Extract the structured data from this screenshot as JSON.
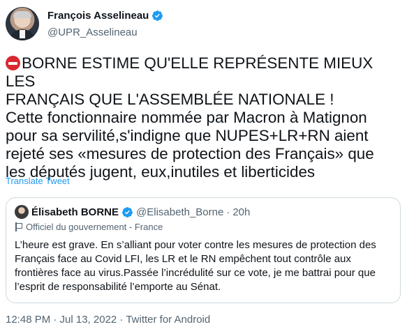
{
  "author": {
    "display_name": "François Asselineau",
    "handle": "@UPR_Asselineau",
    "verified_icon": "verified-badge-icon",
    "avatar_icon": "avatar"
  },
  "tweet": {
    "emoji_icon": "no-entry-icon",
    "text": "BORNE ESTIME QU'ELLE REPRÉSENTE MIEUX LES\nFRANÇAIS QUE L'ASSEMBLÉE NATIONALE !\nCette fonctionnaire nommée par Macron à Matignon\npour sa servilité,s'indigne que NUPES+LR+RN aient\nrejeté ses «mesures de protection des Français» que\nles députés jugent, eux,inutiles et liberticides",
    "translate_label": "Translate Tweet"
  },
  "quote": {
    "display_name": "Élisabeth BORNE",
    "handle": "@Elisabeth_Borne",
    "separator": "·",
    "time": "20h",
    "label": "Officiel du gouvernement - France",
    "text": "L’heure est grave. En s’alliant pour voter contre les mesures de protection des\nFrançais face au Covid LFI, les LR et le RN empêchent tout contrôle aux\nfrontières face au virus.Passée l’incrédulité sur ce vote, je me battrai pour que\nl’esprit de responsabilité l’emporte au Sénat."
  },
  "meta": {
    "timestamp": "12:48 PM · Jul 13, 2022 · Twitter for Android"
  },
  "colors": {
    "link": "#1d9bf0",
    "secondary_text": "#536471",
    "border": "#cfd9de"
  }
}
